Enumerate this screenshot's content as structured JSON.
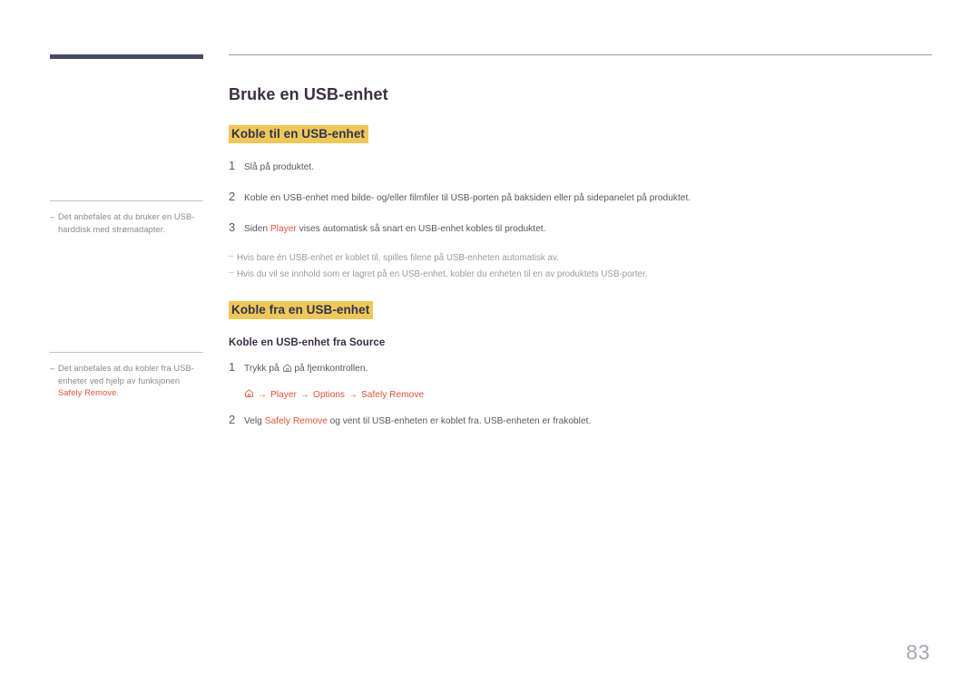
{
  "document": {
    "page_number": "83",
    "title": "Bruke en USB-enhet"
  },
  "colors": {
    "highlight": "#efc85a",
    "accent_orange": "#e0543c",
    "title_dark": "#3b2f45",
    "rule_dark": "#474a63",
    "body_gray": "#58585f",
    "note_gray": "#9b9ba3"
  },
  "sidebar": {
    "notes": [
      {
        "marker": "–",
        "text": "Det anbefales at du bruker en USB-harddisk med strømadapter."
      },
      {
        "marker": "–",
        "text_before": "Det anbefales at du kobler fra USB-enheter ved hjelp av funksjonen ",
        "emphasis": "Safely Remove",
        "text_after": "."
      }
    ]
  },
  "main": {
    "section1": {
      "heading": "Koble til en USB-enhet",
      "steps": [
        {
          "num": "1",
          "text": "Slå på produktet."
        },
        {
          "num": "2",
          "text": "Koble en USB-enhet med bilde- og/eller filmfiler til USB-porten på baksiden eller på sidepanelet på produktet."
        },
        {
          "num": "3",
          "text_before": "Siden ",
          "emphasis": "Player",
          "text_after": " vises automatisk så snart en USB-enhet kobles til produktet."
        }
      ],
      "notes": [
        {
          "marker": "–",
          "text": "Hvis bare én USB-enhet er koblet til, spilles filene på USB-enheten automatisk av."
        },
        {
          "marker": "–",
          "text": "Hvis du vil se innhold som er lagret på en USB-enhet, kobler du enheten til en av produktets USB-porter."
        }
      ]
    },
    "section2": {
      "heading": "Koble fra en USB-enhet",
      "subheading": "Koble en USB-enhet fra Source",
      "steps": [
        {
          "num": "1",
          "text_before": "Trykk på ",
          "icon": "home-icon",
          "text_after": " på fjernkontrollen."
        },
        {
          "num": "2",
          "text_before": "Velg ",
          "emphasis": "Safely Remove",
          "text_after": " og vent til USB-enheten er koblet fra. USB-enheten er frakoblet."
        }
      ],
      "breadcrumb": {
        "icon": "home-icon",
        "arrow": "→",
        "items": [
          "Player",
          "Options",
          "Safely Remove"
        ]
      }
    }
  }
}
